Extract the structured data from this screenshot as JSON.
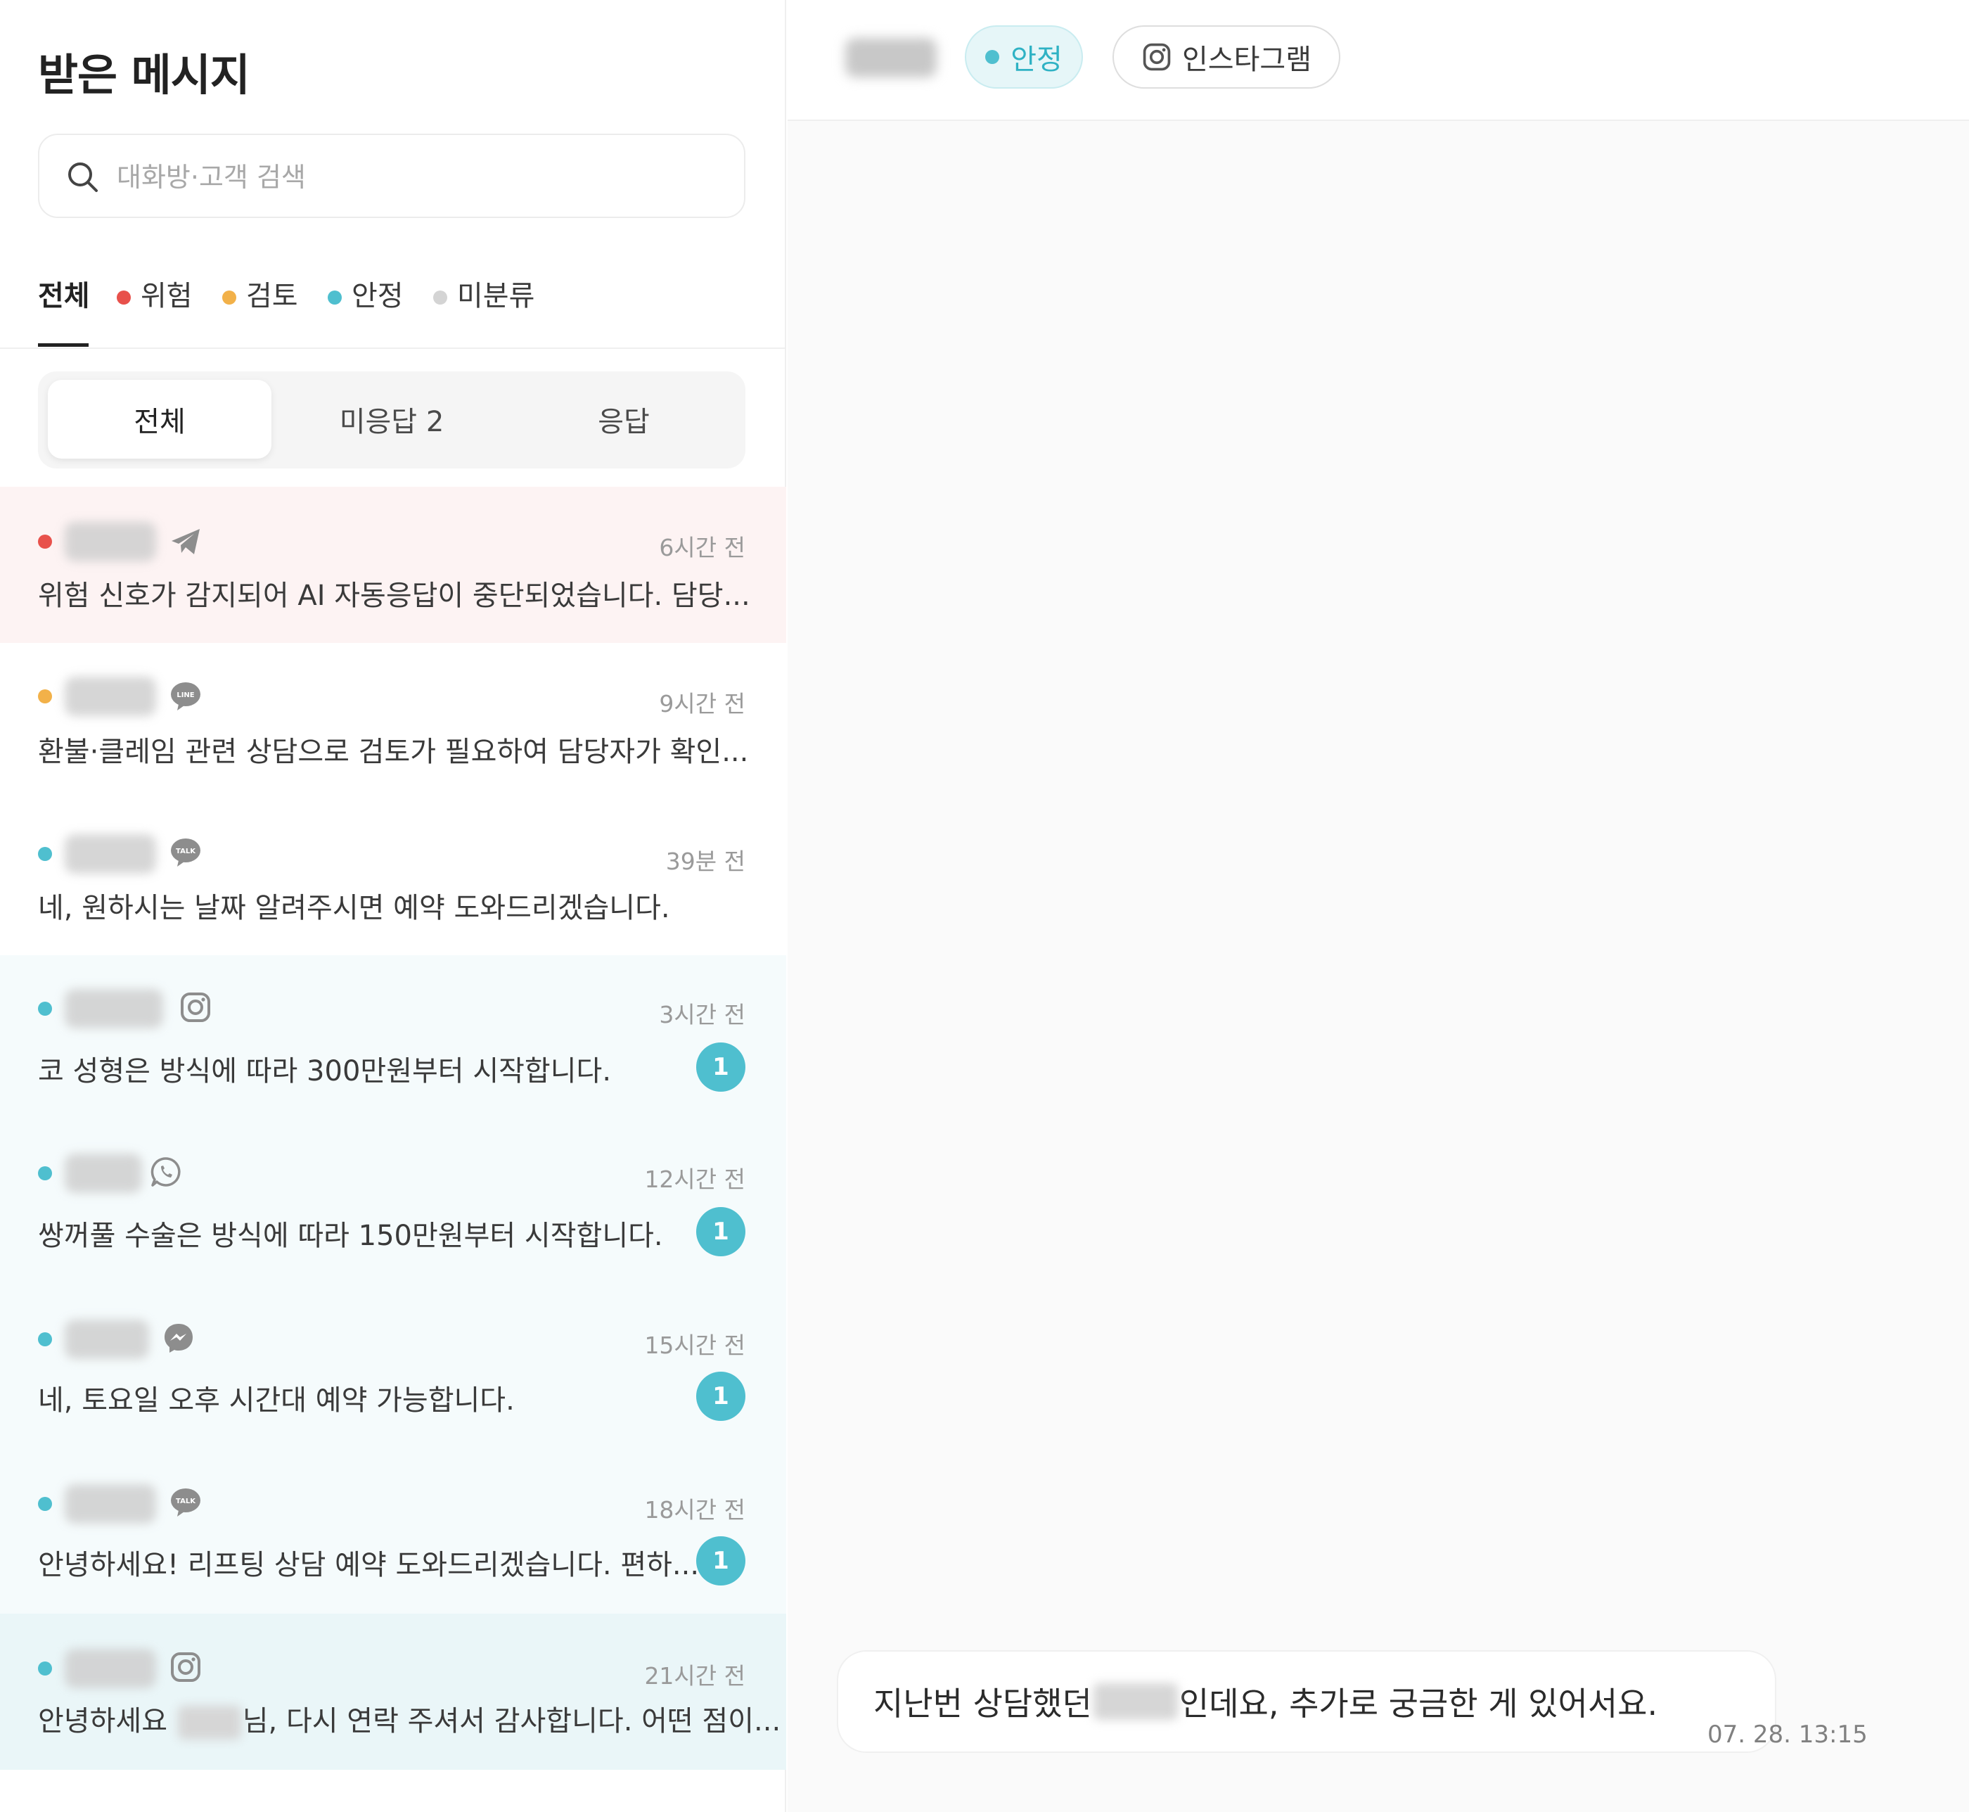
{
  "inbox": {
    "title": "받은 메시지",
    "search_placeholder": "대화방·고객 검색",
    "filter_tabs": [
      {
        "label": "전체",
        "dot_color": null
      },
      {
        "label": "위험",
        "dot_color": "#e8514b"
      },
      {
        "label": "검토",
        "dot_color": "#f2b149"
      },
      {
        "label": "안정",
        "dot_color": "#4fbfcf"
      },
      {
        "label": "미분류",
        "dot_color": "#d4d4d4"
      }
    ],
    "segments": [
      {
        "label": "전체"
      },
      {
        "label": "미응답 2"
      },
      {
        "label": "응답"
      }
    ],
    "conversations": [
      {
        "status_color": "#e8514b",
        "channel_icon": "telegram-icon",
        "time": "6시간 전",
        "preview": "위험 신호가 감지되어 AI 자동응답이 중단되었습니다. 담당...",
        "unread": null
      },
      {
        "status_color": "#f2b149",
        "channel_icon": "line-icon",
        "time": "9시간 전",
        "preview": "환불·클레임 관련 상담으로 검토가 필요하여 담당자가 확인...",
        "unread": null
      },
      {
        "status_color": "#4fbfcf",
        "channel_icon": "kakaotalk-icon",
        "time": "39분 전",
        "preview": "네, 원하시는 날짜 알려주시면 예약 도와드리겠습니다.",
        "unread": null
      },
      {
        "status_color": "#4fbfcf",
        "channel_icon": "instagram-icon",
        "time": "3시간 전",
        "preview": "코 성형은 방식에 따라 300만원부터 시작합니다.",
        "unread": "1"
      },
      {
        "status_color": "#4fbfcf",
        "channel_icon": "whatsapp-icon",
        "time": "12시간 전",
        "preview": "쌍꺼풀 수술은 방식에 따라 150만원부터 시작합니다.",
        "unread": "1"
      },
      {
        "status_color": "#4fbfcf",
        "channel_icon": "messenger-icon",
        "time": "15시간 전",
        "preview": "네, 토요일 오후 시간대 예약 가능합니다.",
        "unread": "1"
      },
      {
        "status_color": "#4fbfcf",
        "channel_icon": "kakaotalk-icon",
        "time": "18시간 전",
        "preview": "안녕하세요! 리프팅 상담 예약 도와드리겠습니다. 편하...",
        "unread": "1"
      },
      {
        "status_color": "#4fbfcf",
        "channel_icon": "instagram-icon",
        "time": "21시간 전",
        "preview_before": "안녕하세요 ",
        "preview_after": "님, 다시 연락 주셔서 감사합니다. 어떤 점이...",
        "unread": null
      }
    ]
  },
  "chat": {
    "status_label": "안정",
    "channel_label": "인스타그램",
    "message_before": "지난번 상담했던 ",
    "message_after": "인데요, 추가로 궁금한 게 있어서요.",
    "message_time": "07. 28. 13:15"
  },
  "colors": {
    "accent": "#4fbfcf",
    "danger": "#e8514b",
    "review": "#f2b149",
    "unclassified": "#d4d4d4"
  }
}
